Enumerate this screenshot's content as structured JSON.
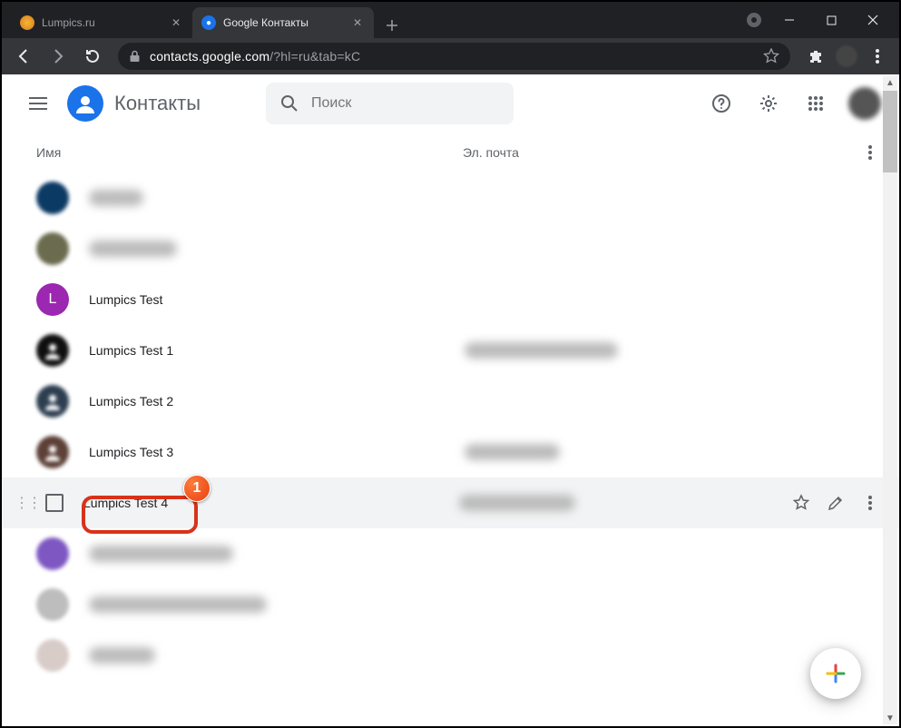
{
  "browser": {
    "tabs": [
      {
        "title": "Lumpics.ru",
        "active": false
      },
      {
        "title": "Google Контакты",
        "active": true
      }
    ],
    "url_host": "contacts.google.com",
    "url_path": "/?hl=ru&tab=kC"
  },
  "app": {
    "title": "Контакты",
    "search_placeholder": "Поиск"
  },
  "columns": {
    "name": "Имя",
    "email": "Эл. почта"
  },
  "contacts": [
    {
      "name": "",
      "email": "",
      "avatar_color": "#0b3a64",
      "blurred": true
    },
    {
      "name": "",
      "email": "",
      "avatar_color": "#6b6b4f",
      "blurred": true
    },
    {
      "name": "Lumpics Test",
      "email": "",
      "avatar_color": "#9c27b0",
      "letter": "L",
      "blurred": false
    },
    {
      "name": "Lumpics Test 1",
      "email": "",
      "avatar_color": "#0f0f0f",
      "blurred": false,
      "blur_email": true,
      "img": true
    },
    {
      "name": "Lumpics Test 2",
      "email": "",
      "avatar_color": "#2c3e50",
      "blurred": false,
      "img": true
    },
    {
      "name": "Lumpics Test 3",
      "email": "",
      "avatar_color": "#5d4037",
      "blurred": false,
      "blur_email": true,
      "img": true
    },
    {
      "name": "Lumpics Test 4",
      "email": "",
      "avatar_color": "",
      "blurred": false,
      "hovered": true,
      "blur_email": true
    },
    {
      "name": "",
      "email": "",
      "avatar_color": "#7e57c2",
      "blurred": true
    },
    {
      "name": "",
      "email": "",
      "avatar_color": "#bdbdbd",
      "blurred": true
    },
    {
      "name": "",
      "email": "",
      "avatar_color": "#d7ccc8",
      "blurred": true
    }
  ],
  "annotation": {
    "badge": "1"
  }
}
